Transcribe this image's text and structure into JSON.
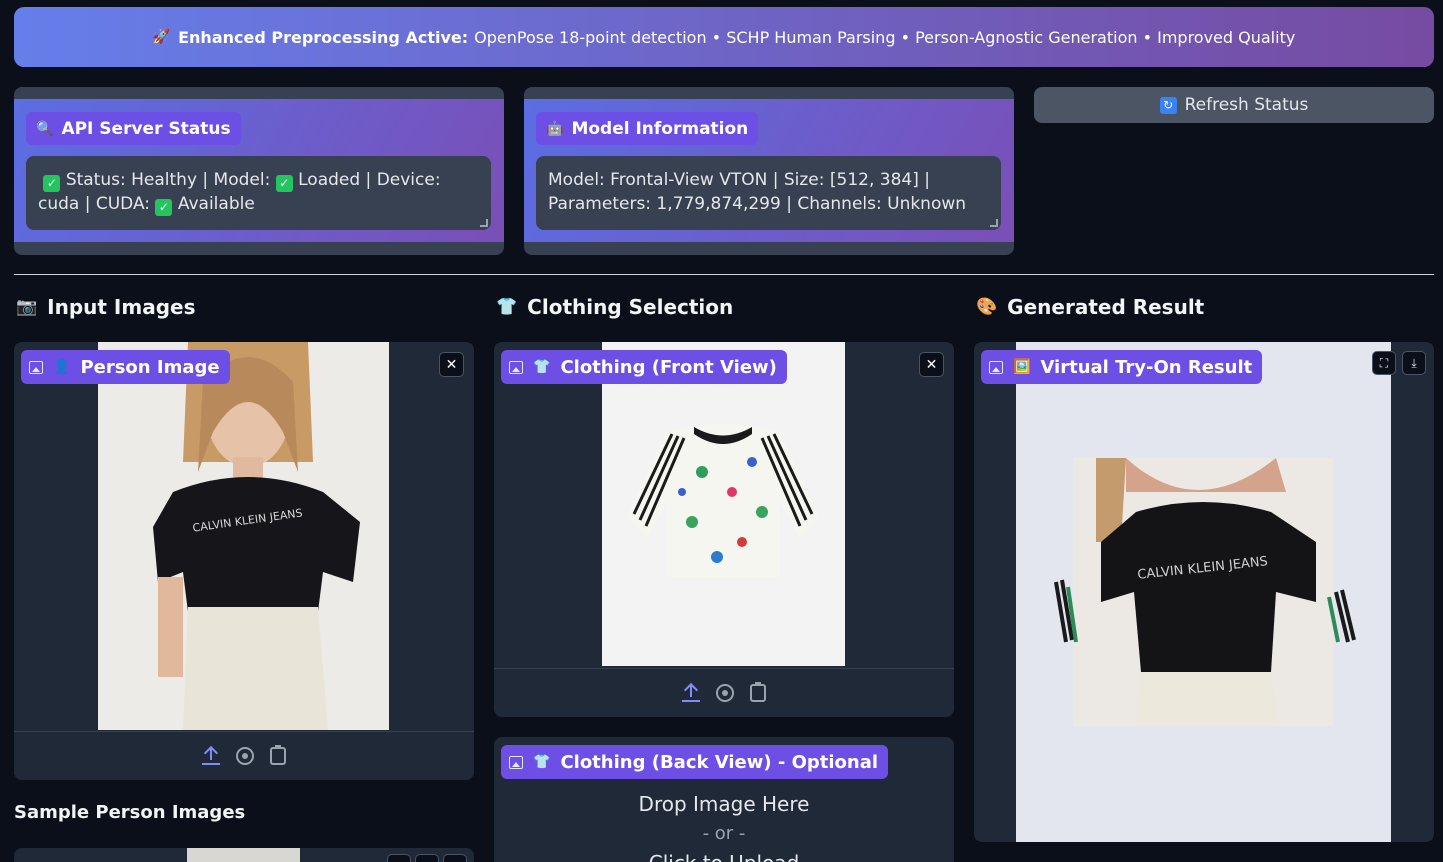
{
  "banner": {
    "emoji": "🚀",
    "bold": "Enhanced Preprocessing Active:",
    "text": "OpenPose 18-point detection • SCHP Human Parsing • Person-Agnostic Generation • Improved Quality"
  },
  "api_status": {
    "emoji": "🔍",
    "title": "API Server Status",
    "line1_a": "Status: Healthy | Model:",
    "line1_b": "Loaded | Device:",
    "line2_a": "cuda | CUDA:",
    "line2_b": "Available"
  },
  "model_info": {
    "emoji": "🤖",
    "title": "Model Information",
    "line1": "Model: Frontal-View VTON | Size: [512, 384] |",
    "line2": "Parameters: 1,779,874,299 | Channels: Unknown"
  },
  "refresh": {
    "icon": "🔄",
    "label": "Refresh Status"
  },
  "columns": {
    "input": {
      "emoji": "📷",
      "title": "Input Images"
    },
    "clothing": {
      "emoji": "👕",
      "title": "Clothing Selection"
    },
    "result": {
      "emoji": "🎨",
      "title": "Generated Result"
    }
  },
  "person_panel": {
    "emoji": "👤",
    "label": "Person Image"
  },
  "front_panel": {
    "emoji": "👕",
    "label": "Clothing (Front View)"
  },
  "back_panel": {
    "emoji": "👕",
    "label": "Clothing (Back View) - Optional",
    "drop": "Drop Image Here",
    "or": "- or -",
    "click": "Click to Upload"
  },
  "result_panel": {
    "emoji": "🖼️",
    "label": "Virtual Try-On Result"
  },
  "sample_title": "Sample Person Images",
  "shirt_print": "CALVIN KLEIN JEANS",
  "icons": [
    "rocket-icon",
    "magnifier-icon",
    "robot-icon",
    "refresh-icon",
    "camera-icon",
    "shirt-icon",
    "palette-icon",
    "image-icon",
    "upload-icon",
    "webcam-icon",
    "clipboard-icon",
    "close-icon",
    "fullscreen-icon",
    "download-icon"
  ]
}
